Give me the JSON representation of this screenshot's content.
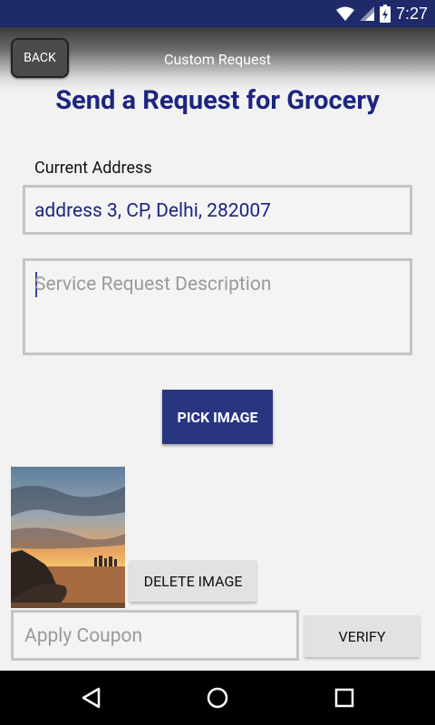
{
  "status_bar": {
    "time": "7:27"
  },
  "toolbar": {
    "back_label": "BACK",
    "title": "Custom Request"
  },
  "page": {
    "title": "Send a Request for Grocery"
  },
  "address": {
    "label": "Current Address",
    "value": "address 3, CP, Delhi, 282007"
  },
  "description": {
    "placeholder": "Service Request Description"
  },
  "buttons": {
    "pick_image": "PICK IMAGE",
    "delete_image": "DELETE IMAGE",
    "verify": "VERIFY"
  },
  "coupon": {
    "placeholder": "Apply Coupon"
  },
  "colors": {
    "primary": "#283580",
    "title_text": "#1d2580",
    "status_bar": "#1f2a6b"
  },
  "icons": [
    "wifi-icon",
    "signal-icon",
    "battery-icon",
    "nav-back-icon",
    "nav-home-icon",
    "nav-recents-icon"
  ]
}
